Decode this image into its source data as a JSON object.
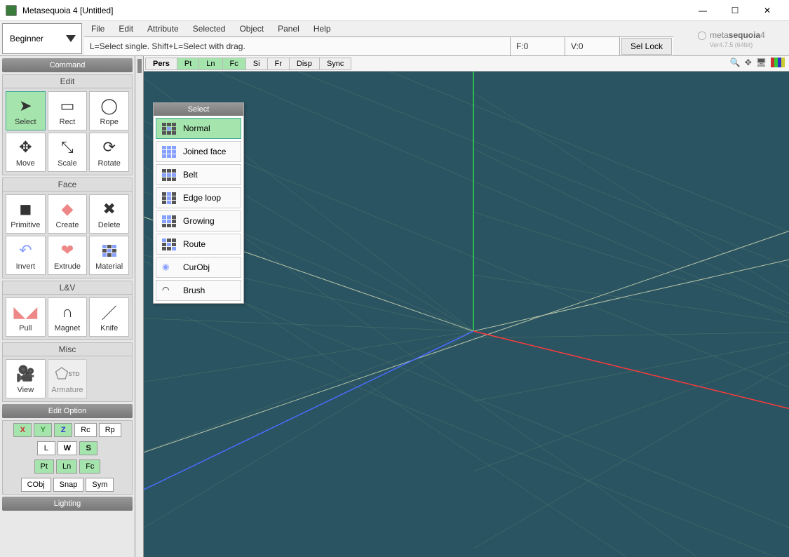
{
  "title": "Metasequoia 4 [Untitled]",
  "window": {
    "minimize": "—",
    "maximize": "☐",
    "close": "✕"
  },
  "mode": "Beginner",
  "menu": {
    "file": "File",
    "edit": "Edit",
    "attribute": "Attribute",
    "selected": "Selected",
    "object": "Object",
    "panel": "Panel",
    "help": "Help"
  },
  "status": {
    "hint": "L=Select single.  Shift+L=Select with drag.",
    "f": "F:0",
    "v": "V:0",
    "sellock": "Sel Lock"
  },
  "logo": {
    "brand1": "meta",
    "brand2": "sequoia",
    "brand3": "4",
    "version": "Ver4.7.5 (64bit)"
  },
  "view_tabs": {
    "pers": "Pers",
    "pt": "Pt",
    "ln": "Ln",
    "fc": "Fc",
    "si": "Si",
    "fr": "Fr",
    "disp": "Disp",
    "sync": "Sync"
  },
  "command_panel": {
    "title": "Command",
    "edit_title": "Edit",
    "tools_edit": {
      "select": "Select",
      "rect": "Rect",
      "rope": "Rope",
      "move": "Move",
      "scale": "Scale",
      "rotate": "Rotate"
    },
    "face_title": "Face",
    "tools_face": {
      "primitive": "Primitive",
      "create": "Create",
      "delete": "Delete",
      "invert": "Invert",
      "extrude": "Extrude",
      "material": "Material"
    },
    "lv_title": "L&V",
    "tools_lv": {
      "pull": "Pull",
      "magnet": "Magnet",
      "knife": "Knife"
    },
    "misc_title": "Misc",
    "tools_misc": {
      "view": "View",
      "armature": "Armature"
    }
  },
  "edit_option": {
    "title": "Edit Option",
    "x": "X",
    "y": "Y",
    "z": "Z",
    "rc": "Rc",
    "rp": "Rp",
    "l": "L",
    "w": "W",
    "s": "S",
    "pt": "Pt",
    "ln": "Ln",
    "fc": "Fc",
    "cobj": "CObj",
    "snap": "Snap",
    "sym": "Sym"
  },
  "lighting": {
    "title": "Lighting"
  },
  "popup": {
    "title": "Select",
    "items": {
      "normal": "Normal",
      "joined": "Joined face",
      "belt": "Belt",
      "edge": "Edge loop",
      "growing": "Growing",
      "route": "Route",
      "curobj": "CurObj",
      "brush": "Brush"
    }
  }
}
